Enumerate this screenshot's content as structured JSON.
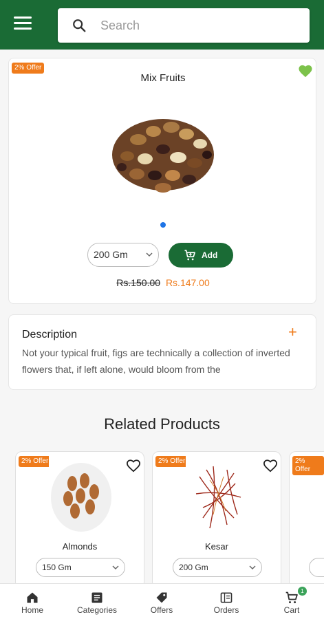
{
  "header": {
    "search_placeholder": "Search",
    "color": "#1a6b35"
  },
  "product": {
    "offer": "2% Offer",
    "title": "Mix Fruits",
    "image": "mixed-dry-fruits",
    "carousel_indicator_color": "#1e74e6",
    "size_selected": "200 Gm",
    "add_label": "Add",
    "old_price": "Rs.150.00",
    "new_price": "Rs.147.00",
    "wishlisted": true
  },
  "description": {
    "title": "Description",
    "toggle": "+",
    "text": "Not your typical fruit, figs are technically a collection of inverted flowers that, if left alone, would bloom from the"
  },
  "related": {
    "title": "Related Products",
    "items": [
      {
        "offer": "2% Offer",
        "name": "Almonds",
        "size": "150 Gm",
        "image": "almonds-bowl"
      },
      {
        "offer": "2% Offer",
        "name": "Kesar",
        "size": "200 Gm",
        "image": "saffron-threads"
      },
      {
        "offer": "2% Offer",
        "name": "",
        "size": "",
        "image": ""
      }
    ]
  },
  "nav": {
    "items": [
      {
        "label": "Home",
        "icon": "home-icon"
      },
      {
        "label": "Categories",
        "icon": "categories-icon"
      },
      {
        "label": "Offers",
        "icon": "offers-tag-icon"
      },
      {
        "label": "Orders",
        "icon": "orders-icon"
      },
      {
        "label": "Cart",
        "icon": "cart-icon"
      }
    ],
    "cart_count": "1"
  },
  "colors": {
    "accent": "#ef7b1b",
    "primary": "#1a6b35",
    "heart": "#7cc24a"
  }
}
